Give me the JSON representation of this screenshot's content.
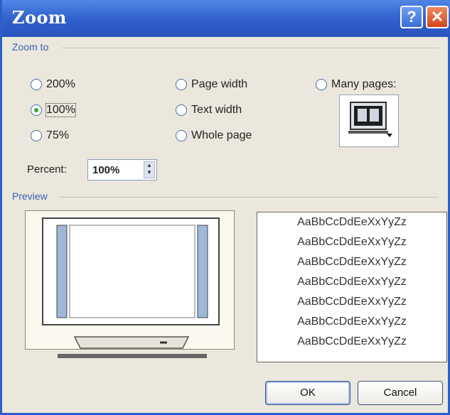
{
  "window": {
    "title": "Zoom",
    "help_glyph": "?",
    "close_glyph": "✕"
  },
  "zoom_to": {
    "group_label": "Zoom to",
    "options": [
      {
        "label": "200%",
        "selected": false
      },
      {
        "label": "100%",
        "selected": true
      },
      {
        "label": "75%",
        "selected": false
      },
      {
        "label": "Page width",
        "selected": false
      },
      {
        "label": "Text width",
        "selected": false
      },
      {
        "label": "Whole page",
        "selected": false
      },
      {
        "label": "Many pages:",
        "selected": false
      }
    ],
    "many_pages_icon": "computer-monitor-icon"
  },
  "percent": {
    "label": "Percent:",
    "value": "100%"
  },
  "preview": {
    "group_label": "Preview",
    "sample_lines": [
      "AaBbCcDdEeXxYyZz",
      "AaBbCcDdEeXxYyZz",
      "AaBbCcDdEeXxYyZz",
      "AaBbCcDdEeXxYyZz",
      "AaBbCcDdEeXxYyZz",
      "AaBbCcDdEeXxYyZz",
      "AaBbCcDdEeXxYyZz"
    ]
  },
  "buttons": {
    "ok": "OK",
    "cancel": "Cancel"
  },
  "colors": {
    "title_bar": "#2f5fcb",
    "group_label": "#3a62b8",
    "radio_selected": "#3aa33a",
    "close_button": "#d4451d"
  }
}
